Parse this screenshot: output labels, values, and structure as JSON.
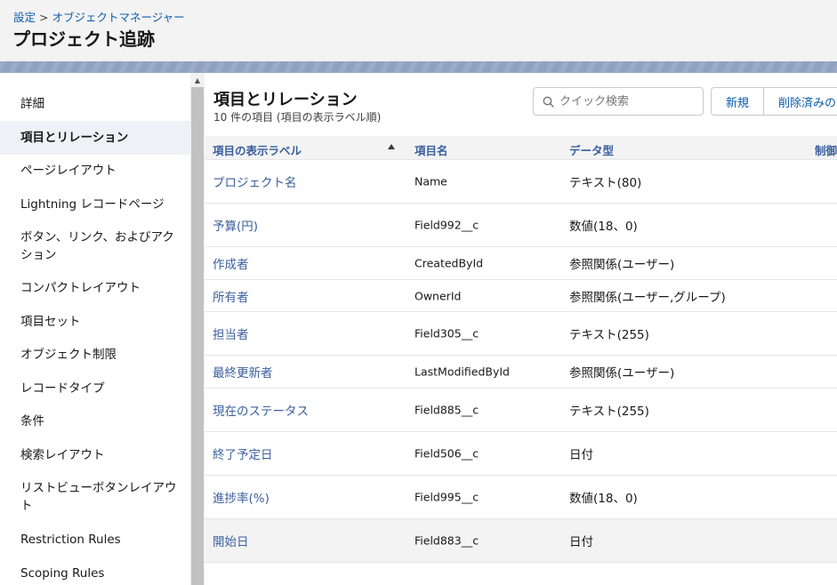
{
  "header": {
    "breadcrumb": {
      "settings": "設定",
      "separator": ">",
      "object_manager": "オブジェクトマネージャー"
    },
    "title": "プロジェクト追跡"
  },
  "sidebar": {
    "items": [
      {
        "label": "詳細",
        "active": false
      },
      {
        "label": "項目とリレーション",
        "active": true
      },
      {
        "label": "ページレイアウト",
        "active": false
      },
      {
        "label": "Lightning レコードページ",
        "active": false
      },
      {
        "label": "ボタン、リンク、およびアクション",
        "active": false
      },
      {
        "label": "コンパクトレイアウト",
        "active": false
      },
      {
        "label": "項目セット",
        "active": false
      },
      {
        "label": "オブジェクト制限",
        "active": false
      },
      {
        "label": "レコードタイプ",
        "active": false
      },
      {
        "label": "条件",
        "active": false
      },
      {
        "label": "検索レイアウト",
        "active": false
      },
      {
        "label": "リストビューボタンレイアウト",
        "active": false
      },
      {
        "label": "Restriction Rules",
        "active": false
      },
      {
        "label": "Scoping Rules",
        "active": false
      }
    ]
  },
  "main": {
    "title": "項目とリレーション",
    "subtitle": "10 件の項目 (項目の表示ラベル順)",
    "search": {
      "placeholder": "クイック検索",
      "value": ""
    },
    "buttons": {
      "new": "新規",
      "deleted": "削除済みの"
    },
    "table": {
      "headers": {
        "label": "項目の表示ラベル",
        "api": "項目名",
        "type": "データ型",
        "control": "制御"
      },
      "rows": [
        {
          "label": "プロジェクト名",
          "api": "Name",
          "type": "テキスト(80)"
        },
        {
          "label": "予算(円)",
          "api": "Field992__c",
          "type": "数値(18、0)"
        },
        {
          "label": "作成者",
          "api": "CreatedById",
          "type": "参照関係(ユーザー)"
        },
        {
          "label": "所有者",
          "api": "OwnerId",
          "type": "参照関係(ユーザー,グループ)"
        },
        {
          "label": "担当者",
          "api": "Field305__c",
          "type": "テキスト(255)"
        },
        {
          "label": "最終更新者",
          "api": "LastModifiedById",
          "type": "参照関係(ユーザー)"
        },
        {
          "label": "現在のステータス",
          "api": "Field885__c",
          "type": "テキスト(255)"
        },
        {
          "label": "終了予定日",
          "api": "Field506__c",
          "type": "日付"
        },
        {
          "label": "進捗率(%)",
          "api": "Field995__c",
          "type": "数値(18、0)"
        },
        {
          "label": "開始日",
          "api": "Field883__c",
          "type": "日付"
        }
      ]
    }
  },
  "colors": {
    "link": "#3a5f9e",
    "breadcrumb": "#0b5cab",
    "banner": "#8fa3c0",
    "header_bg": "#f3f3f3"
  }
}
